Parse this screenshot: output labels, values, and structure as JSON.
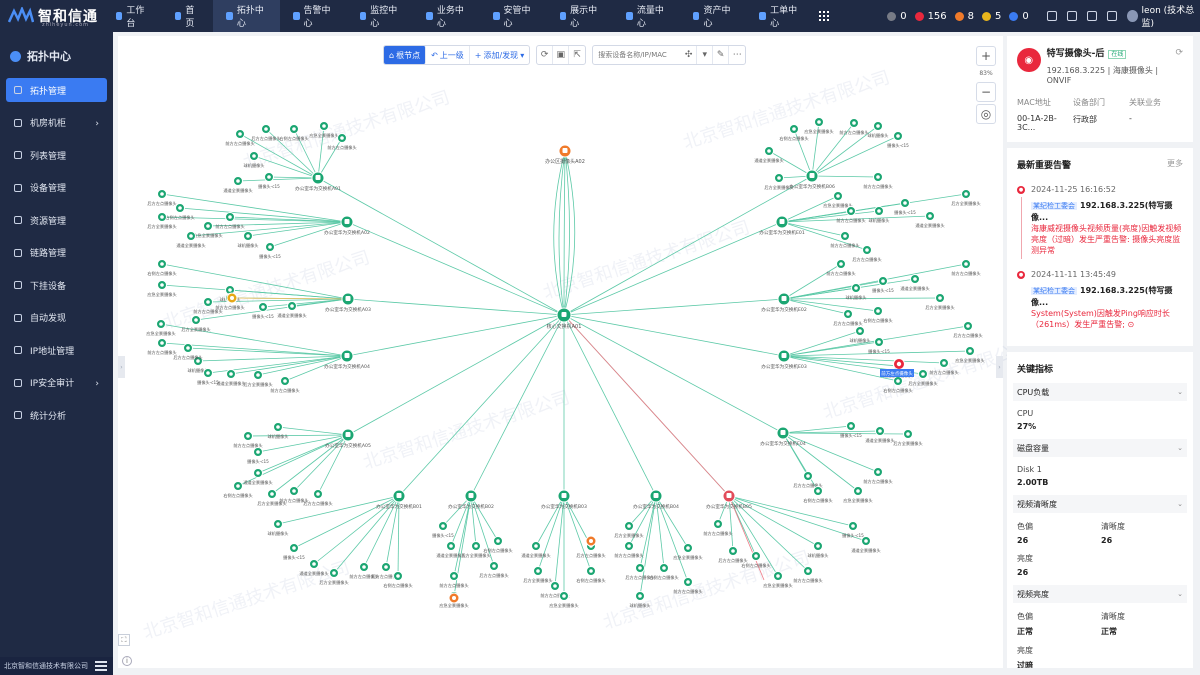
{
  "brand": {
    "name": "智和信通",
    "sub": "zhiheyun.com"
  },
  "nav": [
    "工作台",
    "首页",
    "拓扑中心",
    "告警中心",
    "监控中心",
    "业务中心",
    "安管中心",
    "展示中心",
    "流量中心",
    "资产中心",
    "工单中心"
  ],
  "alarm_counts": [
    {
      "count": "0",
      "color": "#777b86"
    },
    {
      "count": "156",
      "color": "#e9283d"
    },
    {
      "count": "8",
      "color": "#f07a2a"
    },
    {
      "count": "5",
      "color": "#e8b51c"
    },
    {
      "count": "0",
      "color": "#3a7bf2"
    }
  ],
  "user": "leon (技术总监)",
  "sidebar": {
    "title": "拓扑中心",
    "items": [
      "拓扑管理",
      "机房机柜",
      "列表管理",
      "设备管理",
      "资源管理",
      "链路管理",
      "下挂设备",
      "自动发现",
      "IP地址管理",
      "IP安全审计",
      "统计分析"
    ],
    "footer": "北京智和信通技术有限公司"
  },
  "toolbar": {
    "root": "根节点",
    "up": "上一级",
    "add": "添加/发现",
    "search_placeholder": "搜索设备名称/IP/MAC"
  },
  "zoom": {
    "level": "83%"
  },
  "watermark": "北京智和信通技术有限公司",
  "topology": {
    "core": "核心交换机A01",
    "top": "办公区摄像头A02",
    "switches": [
      "办公室华为交换机A01",
      "办公室华为交换机A02",
      "办公室华为交换机A03",
      "办公室华为交换机A04",
      "办公室华为交换机A05",
      "办公室华为交换机B01",
      "办公室华为交换机B02",
      "办公室华为交换机B03",
      "办公室华为交换机B04",
      "办公室华为交换机B05",
      "办公室华为交换机B06",
      "办公室华为交换机E01",
      "办公室华为交换机E02",
      "办公室华为交换机E03",
      "办公室华为交换机E04",
      "办公室华为交换机E05"
    ],
    "cam_labels": [
      "前方左点摄像头",
      "后方左点摄像头",
      "右侧左点摄像头",
      "应急全景摄像头",
      "前方左点摄像头",
      "球机摄像头",
      "摄像头-c15",
      "通道全景摄像头",
      "后方全景摄像头"
    ],
    "selected_label": "前方左点摄像头"
  },
  "device": {
    "name": "特写摄像头-后",
    "status": "在线",
    "sub": "192.168.3.225 | 海康摄像头 | ONVIF",
    "fields": [
      {
        "k": "MAC地址",
        "v": "00-1A-2B-3C..."
      },
      {
        "k": "设备部门",
        "v": "行政部"
      },
      {
        "k": "关联业务",
        "v": "-"
      }
    ]
  },
  "alarms": {
    "title": "最新重要告警",
    "more": "更多",
    "items": [
      {
        "time": "2024-11-25 16:16:52",
        "tag": "某纪检工委会",
        "host": "192.168.3.225(特写摄像...",
        "msg": "海康威视摄像头视频质量(亮度)因触发视频亮度（过暗）发生严重告警: 摄像头亮度监测异常"
      },
      {
        "time": "2024-11-11 13:45:49",
        "tag": "某纪检工委会",
        "host": "192.168.3.225(特写摄像...",
        "msg": "System(System)因触发Ping响应时长（261ms）发生严重告警; ⊙"
      }
    ]
  },
  "metrics": {
    "title": "关键指标",
    "groups": [
      {
        "name": "CPU负载",
        "rows": [
          [
            {
              "k": "CPU",
              "v": "27%"
            }
          ]
        ]
      },
      {
        "name": "磁盘容量",
        "rows": [
          [
            {
              "k": "Disk 1",
              "v": "2.00TB"
            }
          ]
        ]
      },
      {
        "name": "视频清晰度",
        "rows": [
          [
            {
              "k": "色偏",
              "v": "26"
            },
            {
              "k": "清晰度",
              "v": "26"
            }
          ],
          [
            {
              "k": "亮度",
              "v": "26"
            }
          ]
        ]
      },
      {
        "name": "视频亮度",
        "rows": [
          [
            {
              "k": "色偏",
              "v": "正常"
            },
            {
              "k": "清晰度",
              "v": "正常"
            }
          ],
          [
            {
              "k": "亮度",
              "v": "过暗"
            }
          ]
        ]
      }
    ]
  }
}
